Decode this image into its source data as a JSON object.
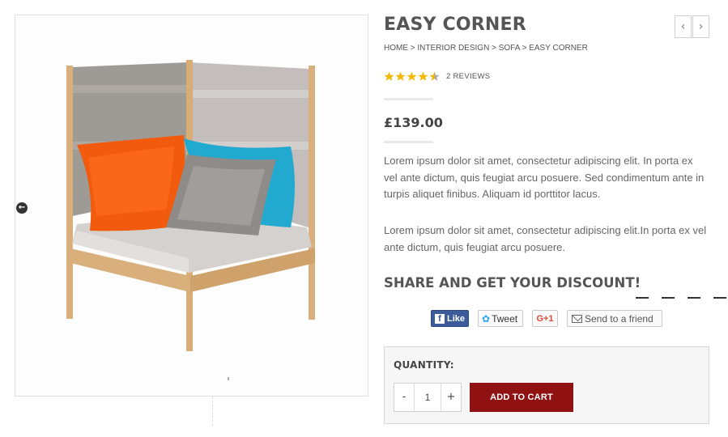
{
  "product": {
    "title": "EASY CORNER",
    "breadcrumb": "HOME > INTERIOR DESIGN > SOFA > EASY CORNER",
    "rating": 4.5,
    "rating_max": 5,
    "reviews_label": "2 REVIEWS",
    "price": "£139.00",
    "description_1": "Lorem ipsum dolor sit amet, consectetur adipiscing elit. In porta ex vel ante dictum, quis feugiat arcu posuere. Sed condimentum ante in turpis aliquet finibus. Aliquam id porttitor lacus.",
    "description_2": "Lorem ipsum dolor sit amet, consectetur adipiscing elit.In porta ex vel ante dictum, quis feugiat arcu posuere."
  },
  "nav": {
    "prev_icon": "chevron-left-icon",
    "next_icon": "chevron-right-icon"
  },
  "share": {
    "heading": "SHARE AND GET YOUR DISCOUNT!",
    "facebook_label": "Like",
    "twitter_label": "Tweet",
    "googleplus_label": "G+1",
    "email_label": "Send to a friend"
  },
  "cart": {
    "quantity_label": "QUANTITY:",
    "minus_label": "-",
    "quantity_value": "1",
    "plus_label": "+",
    "add_to_cart_label": "ADD TO CART"
  },
  "colors": {
    "accent": "#8f1111",
    "star": "#f5b800",
    "facebook": "#3b5b9a",
    "twitter": "#2aa3ef",
    "googleplus": "#dd4b39"
  }
}
